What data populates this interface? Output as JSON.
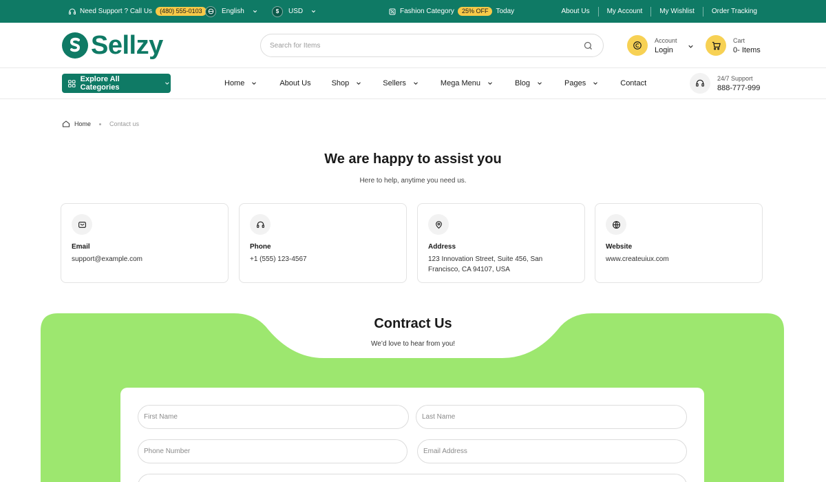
{
  "topbar": {
    "support_label": "Need Support ?  Call Us",
    "phone": "(480) 555-0103",
    "language": "English",
    "currency_symbol": "$",
    "currency": "USD",
    "promo_label": "Fashion Category",
    "promo_badge": "25% OFF",
    "promo_suffix": "Today",
    "links": [
      "About Us",
      "My Account",
      "My Wishlist",
      "Order Tracking"
    ]
  },
  "header": {
    "logo_text": "Sellzy",
    "search_placeholder": "Search for Items",
    "account_small": "Account",
    "account_big": "Login",
    "cart_small": "Cart",
    "cart_big": "0- Items"
  },
  "nav": {
    "explore_label": "Explore All Categories",
    "items": [
      "Home",
      "About Us",
      "Shop",
      "Sellers",
      "Mega Menu",
      "Blog",
      "Pages",
      "Contact"
    ],
    "support_small": "24/7 Support",
    "support_big": "888-777-999"
  },
  "breadcrumb": {
    "home": "Home",
    "current": "Contact us"
  },
  "page": {
    "title": "We are happy to assist you",
    "subtitle": "Here to help, anytime you need us."
  },
  "cards": [
    {
      "icon": "mail-icon",
      "label": "Email",
      "value": "support@example.com"
    },
    {
      "icon": "headset-icon",
      "label": "Phone",
      "value": "+1 (555) 123-4567"
    },
    {
      "icon": "location-pin-icon",
      "label": "Address",
      "value": "123 Innovation Street, Suite 456, San Francisco, CA 94107, USA"
    },
    {
      "icon": "globe-icon",
      "label": "Website",
      "value": "www.createuiux.com"
    }
  ],
  "contact": {
    "title": "Contract Us",
    "subtitle": "We’d love to hear from you!",
    "placeholders": {
      "first_name": "First Name",
      "last_name": "Last Name",
      "phone": "Phone Number",
      "email": "Email Address",
      "message": ""
    }
  },
  "colors": {
    "brand": "#0f7a65",
    "accent_yellow": "#f7c948",
    "contact_green": "#9de76f"
  }
}
